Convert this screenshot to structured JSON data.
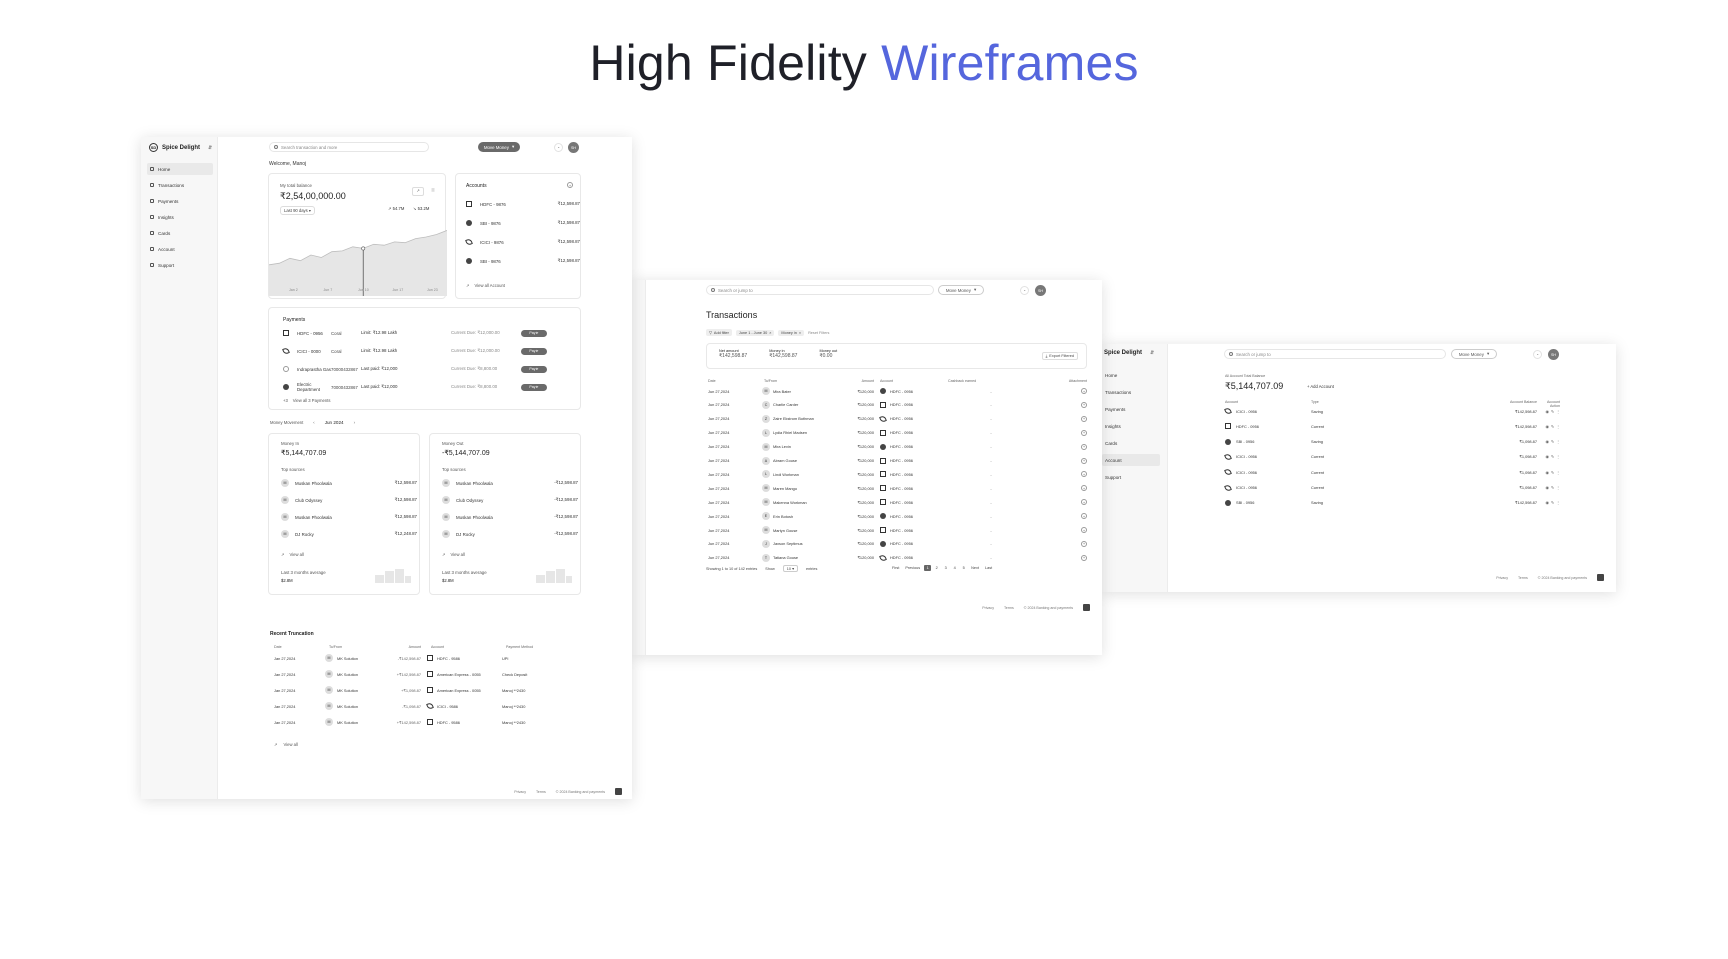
{
  "heading": {
    "part1": "High Fidelity",
    "part2": "Wireframes"
  },
  "colors": {
    "accent": "#5566dd",
    "primary_button": "#6a6a6a"
  },
  "frame1": {
    "brand": "Spice Delight",
    "nav": [
      "Home",
      "Transactions",
      "Payments",
      "Insights",
      "Cards",
      "Account",
      "Support"
    ],
    "search_placeholder": "Search transaction and more",
    "move_money": "Move Money",
    "avatar": "SH",
    "welcome": "Welcome, Manoj",
    "balance": {
      "label": "My total balance",
      "value": "₹2,54,00,000.00",
      "period": "Last 90 days",
      "in_stat": "↗ 54.7M",
      "out_stat": "↘ 53.2M",
      "x_labels": [
        "Jan 2",
        "Jun 7",
        "Jun 10",
        "Jun 17",
        "Jun 23"
      ],
      "series": [
        38,
        40,
        46,
        43,
        50,
        47,
        54,
        55,
        60,
        58,
        63,
        62,
        66,
        65,
        70,
        72,
        75,
        80
      ]
    },
    "accounts": {
      "title": "Accounts",
      "items": [
        {
          "name": "HDFC - 9876",
          "amount": "₹12,598.87",
          "icon": "square"
        },
        {
          "name": "SBI - 9876",
          "amount": "₹12,598.87",
          "icon": "circle"
        },
        {
          "name": "ICICI - 9876",
          "amount": "₹12,598.87",
          "icon": "leaf"
        },
        {
          "name": "SBI - 9876",
          "amount": "₹12,598.87",
          "icon": "circle"
        }
      ],
      "view_all": "View all Account"
    },
    "payments": {
      "title": "Payments",
      "items": [
        {
          "name": "HDFC - 0956",
          "tag": "Coral",
          "limit": "Limit: ₹12.98 Lakh",
          "due": "Current Due: ₹12,000.00",
          "icon": "square"
        },
        {
          "name": "ICICI - 0000",
          "tag": "Coral",
          "limit": "Limit: ₹12.98 Lakh",
          "due": "Current Due: ₹12,000.00",
          "icon": "leaf"
        },
        {
          "name": "Indraprastha Gas",
          "tag": "70000432867",
          "limit": "Last paid: ₹12,000",
          "due": "Current Due: ₹8,800.00",
          "icon": "dot"
        },
        {
          "name": "Electric Department",
          "tag": "70000432867",
          "limit": "Last paid: ₹12,000",
          "due": "Current Due: ₹8,800.00",
          "icon": "circle"
        }
      ],
      "pay_label": "Pay",
      "view_all": "View all 3 Payments"
    },
    "movement": {
      "label": "Money Movement",
      "month": "Jun 2024"
    },
    "money_in": {
      "label": "Money In",
      "value": "₹5,144,707.09",
      "top": "Top sources",
      "items": [
        {
          "name": "Muskan Phoolwala",
          "amount": "₹12,598.87"
        },
        {
          "name": "Club Odyssey",
          "amount": "₹12,598.87"
        },
        {
          "name": "Muskan Phoolwala",
          "amount": "₹12,598.87"
        },
        {
          "name": "DJ Rocky",
          "amount": "₹12,248.87"
        }
      ],
      "view_all": "View all",
      "avg_label": "Last 3 months average",
      "avg_value": "$2.8M"
    },
    "money_out": {
      "label": "Money Out",
      "value": "-₹5,144,707.09",
      "top": "Top sources",
      "items": [
        {
          "name": "Muskan Phoolwala",
          "amount": "-₹12,598.87"
        },
        {
          "name": "Club Odyssey",
          "amount": "-₹12,598.87"
        },
        {
          "name": "Muskan Phoolwala",
          "amount": "-₹12,598.87"
        },
        {
          "name": "DJ Rocky",
          "amount": "-₹12,598.87"
        }
      ],
      "view_all": "View all",
      "avg_label": "Last 3 months average",
      "avg_value": "$2.8M"
    },
    "recent": {
      "title": "Recent Truncation",
      "headers": [
        "Date",
        "To/From",
        "Amount",
        "Account",
        "Payment Method"
      ],
      "rows": [
        {
          "date": "Jan 27,2024",
          "party": "MK Solution",
          "amount": "-₹142,598.87",
          "account": "HDFC - 9586",
          "method": "UPI"
        },
        {
          "date": "Jan 27,2024",
          "party": "MK Solution",
          "amount": "+₹142,598.87",
          "account": "American Express - 0055",
          "method": "Check Deposit"
        },
        {
          "date": "Jan 27,2024",
          "party": "MK Solution",
          "amount": "+₹1,098.87",
          "account": "American Express - 0055",
          "method": "Manoj **2430"
        },
        {
          "date": "Jan 27,2024",
          "party": "MK Solution",
          "amount": "-₹1,098.87",
          "account": "ICICI - 9586",
          "method": "Manoj **2430"
        },
        {
          "date": "Jan 27,2024",
          "party": "MK Solution",
          "amount": "+₹142,598.87",
          "account": "HDFC - 9586",
          "method": "Manoj **2430"
        }
      ],
      "view_all": "View all"
    },
    "footer": {
      "privacy": "Privacy",
      "terms": "Terms",
      "copyright": "© 2024 Banking and payments"
    }
  },
  "frame2": {
    "search_placeholder": "Search or jump to",
    "move_money": "Move Money",
    "avatar": "SH",
    "title": "Transactions",
    "filters": [
      "Add filter",
      "June 1 - June 30",
      "Money in",
      "Reset Filters"
    ],
    "summary": [
      {
        "label": "Net amount",
        "value": "₹142,598.87"
      },
      {
        "label": "Money in",
        "value": "₹142,598.87"
      },
      {
        "label": "Money out",
        "value": "₹0.00"
      }
    ],
    "export": "Export Filtered",
    "headers": [
      "Date",
      "To/From",
      "Amount",
      "Account",
      "Cashback earned",
      "Attachment"
    ],
    "rows": [
      {
        "date": "Jun 27,2024",
        "party": "Mira Bater",
        "amount": "₹120,000",
        "account": "HDFC - 0956",
        "cashback": "-",
        "icon": "circle"
      },
      {
        "date": "Jun 27,2024",
        "party": "Charlie Carder",
        "amount": "₹120,000",
        "account": "HDFC - 0956",
        "cashback": "-",
        "icon": "square"
      },
      {
        "date": "Jun 27,2024",
        "party": "Zaire Ekstrom Bothman",
        "amount": "₹120,000",
        "account": "HDFC - 0956",
        "cashback": "-",
        "icon": "leaf"
      },
      {
        "date": "Jun 27,2024",
        "party": "Lydia Rhiel Madsen",
        "amount": "₹120,000",
        "account": "HDFC - 0956",
        "cashback": "-",
        "icon": "square"
      },
      {
        "date": "Jun 27,2024",
        "party": "Mira Levin",
        "amount": "₹120,000",
        "account": "HDFC - 0956",
        "cashback": "-",
        "icon": "circle"
      },
      {
        "date": "Jun 27,2024",
        "party": "Abram Gouse",
        "amount": "₹120,000",
        "account": "HDFC - 0956",
        "cashback": "-",
        "icon": "square"
      },
      {
        "date": "Jun 27,2024",
        "party": "Lindi Workman",
        "amount": "₹120,000",
        "account": "HDFC - 0956",
        "cashback": "-",
        "icon": "square"
      },
      {
        "date": "Jun 27,2024",
        "party": "Maren Mango",
        "amount": "₹120,000",
        "account": "HDFC - 0956",
        "cashback": "-",
        "icon": "square"
      },
      {
        "date": "Jun 27,2024",
        "party": "Makenna Workman",
        "amount": "₹120,000",
        "account": "HDFC - 0956",
        "cashback": "-",
        "icon": "square"
      },
      {
        "date": "Jun 27,2024",
        "party": "Erin Botosh",
        "amount": "₹120,000",
        "account": "HDFC - 0956",
        "cashback": "-",
        "icon": "circle"
      },
      {
        "date": "Jun 27,2024",
        "party": "Martyn Gouse",
        "amount": "₹120,000",
        "account": "HDFC - 0956",
        "cashback": "-",
        "icon": "square"
      },
      {
        "date": "Jun 27,2024",
        "party": "Jaxson Septimus",
        "amount": "₹120,000",
        "account": "HDFC - 0956",
        "cashback": "-",
        "icon": "circle"
      },
      {
        "date": "Jun 27,2024",
        "party": "Tatiana Gouse",
        "amount": "₹120,000",
        "account": "HDFC - 0956",
        "cashback": "-",
        "icon": "leaf"
      }
    ],
    "showing": "Showing 1 to 10 of 142 entries",
    "show_label": "Show",
    "show_value": "10",
    "entries_label": "entries",
    "pagination": [
      "First",
      "Previous",
      "1",
      "2",
      "3",
      "4",
      "5",
      "Next",
      "Last"
    ],
    "footer": {
      "privacy": "Privacy",
      "terms": "Terms",
      "copyright": "© 2024 Banking and payments"
    }
  },
  "frame3": {
    "brand": "Spice Delight",
    "nav": [
      "Home",
      "Transactions",
      "Payments",
      "Insights",
      "Cards",
      "Account",
      "Support"
    ],
    "search_placeholder": "Search or jump to",
    "move_money": "Move Money",
    "avatar": "SH",
    "total_label": "All Account Total Balance",
    "total_value": "₹5,144,707.09",
    "add_account": "+ Add Account",
    "headers": [
      "Account",
      "Type",
      "Account Balance",
      "Account Action"
    ],
    "rows": [
      {
        "account": "ICICI - 0956",
        "type": "Saving",
        "balance": "₹142,598.87",
        "icon": "leaf"
      },
      {
        "account": "HDFC - 0956",
        "type": "Current",
        "balance": "₹142,598.87",
        "icon": "square"
      },
      {
        "account": "SBI - 0956",
        "type": "Saving",
        "balance": "₹1,098.87",
        "icon": "circle"
      },
      {
        "account": "ICICI - 0956",
        "type": "Current",
        "balance": "₹1,098.87",
        "icon": "leaf"
      },
      {
        "account": "ICICI - 0956",
        "type": "Current",
        "balance": "₹1,098.87",
        "icon": "leaf"
      },
      {
        "account": "ICICI - 0956",
        "type": "Current",
        "balance": "₹1,098.87",
        "icon": "leaf"
      },
      {
        "account": "SBI - 0956",
        "type": "Saving",
        "balance": "₹142,598.87",
        "icon": "circle"
      }
    ],
    "footer": {
      "privacy": "Privacy",
      "terms": "Terms",
      "copyright": "© 2024 Banking and payments"
    }
  }
}
